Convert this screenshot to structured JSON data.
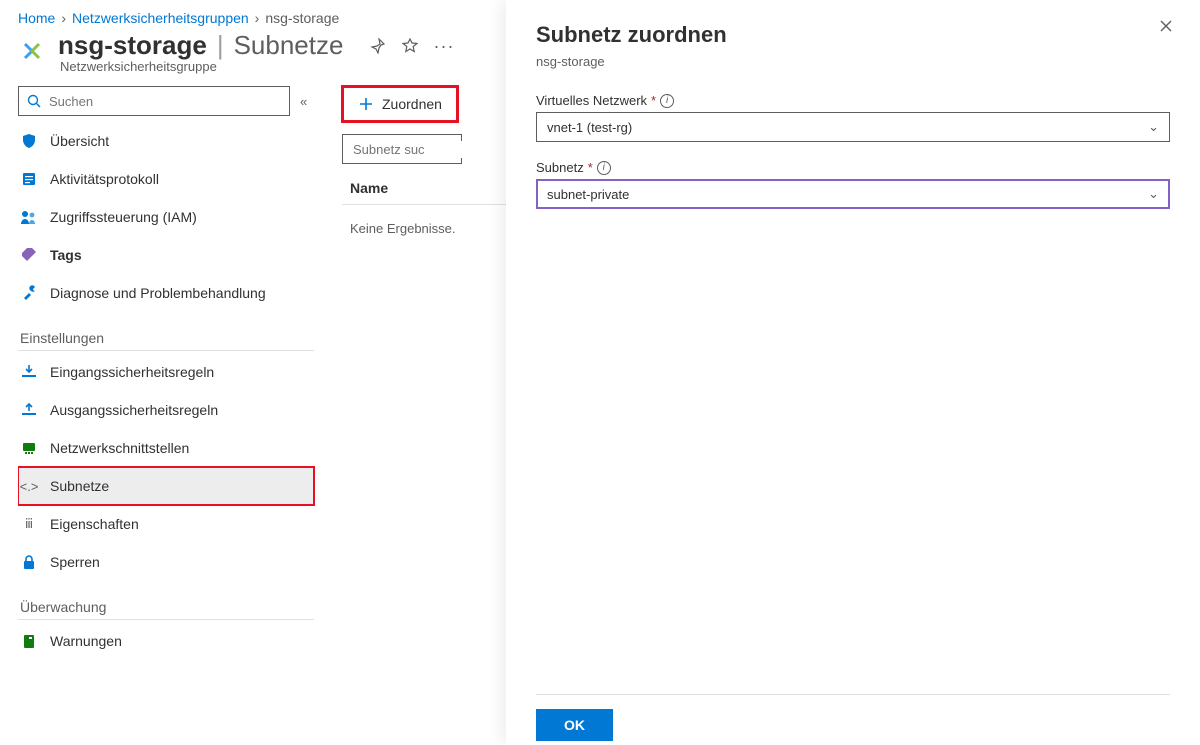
{
  "breadcrumb": {
    "home": "Home",
    "group": "Netzwerksicherheitsgruppen",
    "current": "nsg-storage"
  },
  "header": {
    "name": "nsg-storage",
    "separator": "|",
    "section": "Subnetze",
    "subtitle": "Netzwerksicherheitsgruppe"
  },
  "search": {
    "placeholder": "Suchen"
  },
  "nav": {
    "items": [
      {
        "label": "Übersicht"
      },
      {
        "label": "Aktivitätsprotokoll"
      },
      {
        "label": "Zugriffssteuerung (IAM)"
      },
      {
        "label": "Tags"
      },
      {
        "label": "Diagnose und Problembehandlung"
      }
    ],
    "group_settings": "Einstellungen",
    "settings": [
      {
        "label": "Eingangssicherheitsregeln"
      },
      {
        "label": "Ausgangssicherheitsregeln"
      },
      {
        "label": "Netzwerkschnittstellen"
      },
      {
        "label": "Subnetze"
      },
      {
        "label": "Eigenschaften"
      },
      {
        "label": "Sperren"
      }
    ],
    "group_monitoring": "Überwachung",
    "monitoring": [
      {
        "label": "Warnungen"
      }
    ]
  },
  "toolbar": {
    "assoc": "Zuordnen"
  },
  "subnet_search": {
    "placeholder": "Subnetz suc"
  },
  "table": {
    "col_name": "Name",
    "empty": "Keine Ergebnisse."
  },
  "panel": {
    "title": "Subnetz zuordnen",
    "subtitle": "nsg-storage",
    "vnet_label": "Virtuelles Netzwerk",
    "vnet_value": "vnet-1 (test-rg)",
    "subnet_label": "Subnetz",
    "subnet_value": "subnet-private",
    "ok": "OK"
  }
}
